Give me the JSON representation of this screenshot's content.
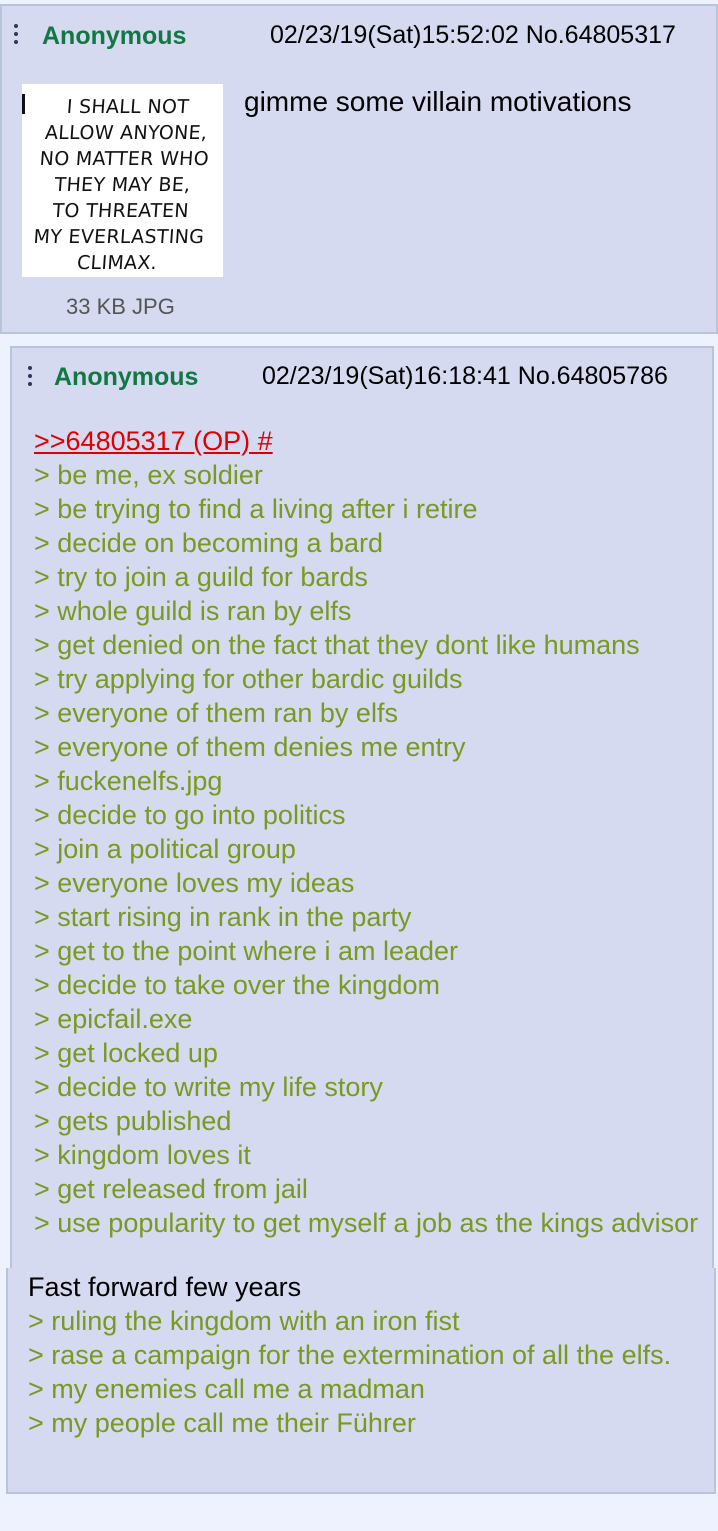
{
  "op_post": {
    "name": "Anonymous",
    "datetime": "02/23/19(Sat)15:52:02",
    "number": "No.64805317",
    "image_text": "I SHALL NOT\nALLOW ANYONE,\nNO MATTER WHO\nTHEY MAY BE,\nTO THREATEN\nMY EVERLASTING\nCLIMAX.",
    "file_info": "33 KB JPG",
    "body": "gimme some villain motivations"
  },
  "reply_post": {
    "name": "Anonymous",
    "datetime": "02/23/19(Sat)16:18:41",
    "number": "No.64805786",
    "quote_link": ">>64805317 (OP) #",
    "lines": [
      "> be me, ex soldier",
      "> be trying to find a living after i retire",
      "> decide on becoming a bard",
      "> try to join a guild for bards",
      "> whole guild is ran by elfs",
      "> get denied on the fact that they dont like humans",
      "> try applying for other bardic guilds",
      "> everyone of them ran by elfs",
      "> everyone of them denies me entry",
      "> fuckenelfs.jpg",
      "> decide to go into politics",
      "> join a political group",
      "> everyone loves my ideas",
      "> start rising in rank in the party",
      "> get to the point where i am leader",
      "> decide to take over the kingdom",
      "> epicfail.exe",
      "> get locked up",
      "> decide to write my life story",
      "> gets published",
      "> kingdom loves it",
      "> get released from jail",
      "> use popularity to get myself a job as the kings advisor"
    ],
    "continuation": {
      "plain": "Fast forward few years",
      "lines": [
        "> ruling the kingdom with an iron fist",
        "> rase a campaign for the extermination of all the elfs.",
        "> my enemies call me a madman",
        "> my people call me their Führer"
      ]
    }
  },
  "colors": {
    "post_bg": "#d6daf0",
    "page_bg": "#eef2ff",
    "name": "#117743",
    "greentext": "#789922",
    "quote_link": "#dd0000"
  }
}
